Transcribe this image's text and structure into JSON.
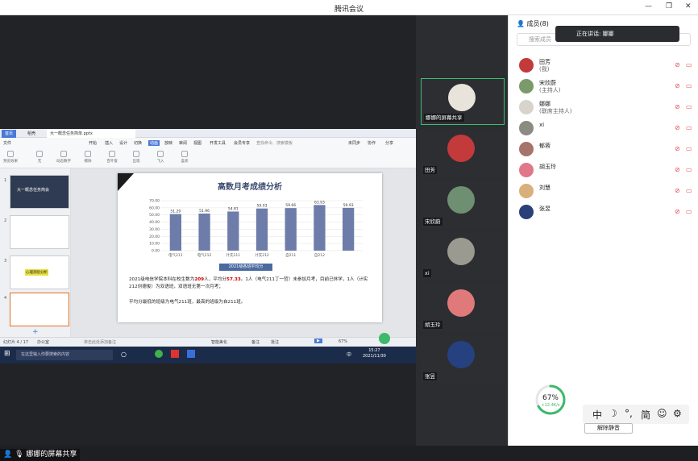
{
  "app": {
    "title": "腾讯会议"
  },
  "share_label": "娜娜的屏幕共享",
  "wps": {
    "tabs": [
      "首页",
      "稻壳",
      "大一概念任务简单.pptx"
    ],
    "menu": [
      "文件",
      "开始",
      "插入",
      "设计",
      "切换",
      "动画",
      "放映",
      "审阅",
      "视图",
      "开发工具",
      "会员专享"
    ],
    "active_menu": "动画",
    "search_placeholder": "查找命令、搜索模板",
    "actions": [
      "未同步",
      "协作",
      "分享"
    ],
    "ribbon_buttons": [
      "预览效果",
      "无",
      "动态数字",
      "擦除",
      "百叶窗",
      "出现",
      "飞入",
      "盒状"
    ],
    "slide_count": "幻灯片 4 / 17",
    "theme": "办公室",
    "zoom": "67%",
    "notes": "单击此处添加备注",
    "status_items": [
      "智能美化",
      "备注",
      "批注"
    ],
    "thumbs": [
      {
        "num": "1",
        "text": "大一概念任务简会"
      },
      {
        "num": "2",
        "text": ""
      },
      {
        "num": "3",
        "text": "心理测验分析"
      },
      {
        "num": "4",
        "text": ""
      }
    ]
  },
  "slide": {
    "title": "高数月考成绩分析",
    "caption": "2021级各班平均分",
    "para1_pre": "2021级电信学院本科在校生数为",
    "para1_n": "209",
    "para1_mid": "人，平均分",
    "para1_avg": "57.33",
    "para1_post": "。1人（电气211丁一哲）未参加月考，目前已休学，1人（计实212刘德俊）为双语班，双语班无第一次月考；",
    "para2": "平均分最低的班级为电气211班，最高的班级为自211班。"
  },
  "chart_data": {
    "type": "bar",
    "categories": [
      "电气211",
      "电气212",
      "计实211",
      "计实212",
      "自211",
      "自212"
    ],
    "values": [
      51.29,
      51.96,
      54.81,
      59.03,
      59.66,
      63.93,
      59.93
    ],
    "title": "",
    "xlabel": "",
    "ylabel": "",
    "ylim": [
      0,
      70
    ],
    "yticks": [
      "0.00",
      "10.00",
      "20.00",
      "30.00",
      "40.00",
      "50.00",
      "60.00",
      "70.00"
    ],
    "bar_color": "#6d7ca8",
    "grid": true
  },
  "taskbar": {
    "search_placeholder": "在这里输入你要搜索的内容",
    "time": "15:27",
    "date": "2021/11/30",
    "badge": "中"
  },
  "speaking": {
    "label": "正在讲话: 娜娜"
  },
  "members": {
    "title": "成员(8)",
    "search_placeholder": "搜索成员",
    "list": [
      {
        "name": "田芳",
        "role": "(我)",
        "color": "#c23a3a"
      },
      {
        "name": "宋欣蔚",
        "role": "(主持人)",
        "color": "#7a9a6a"
      },
      {
        "name": "娜娜",
        "role": "(联席主持人)",
        "color": "#d8d4cc"
      },
      {
        "name": "xi",
        "role": "",
        "color": "#8b8b82"
      },
      {
        "name": "郁蓉",
        "role": "",
        "color": "#a5746a"
      },
      {
        "name": "胡玉玲",
        "role": "",
        "color": "#e0788a"
      },
      {
        "name": "刘慧",
        "role": "",
        "color": "#d9b07a"
      },
      {
        "name": "张昱",
        "role": "",
        "color": "#2b3f78"
      }
    ]
  },
  "tiles": [
    {
      "name": "娜娜的屏幕共享",
      "color": "#e8e4dc"
    },
    {
      "name": "田芳",
      "color": "#c23a3a"
    },
    {
      "name": "宋欣蔚",
      "color": "#6e8f72"
    },
    {
      "name": "xi",
      "color": "#9a9a90"
    },
    {
      "name": "胡玉玲",
      "color": "#e07a7a"
    },
    {
      "name": "张昱",
      "color": "#26417f"
    }
  ],
  "network": {
    "percent": "67%",
    "speed": "+12.4K/s"
  },
  "ime": {
    "items": [
      "中",
      "☽",
      "°,",
      "简",
      "☺",
      "⚙"
    ]
  },
  "unmute_all": "解除静音"
}
